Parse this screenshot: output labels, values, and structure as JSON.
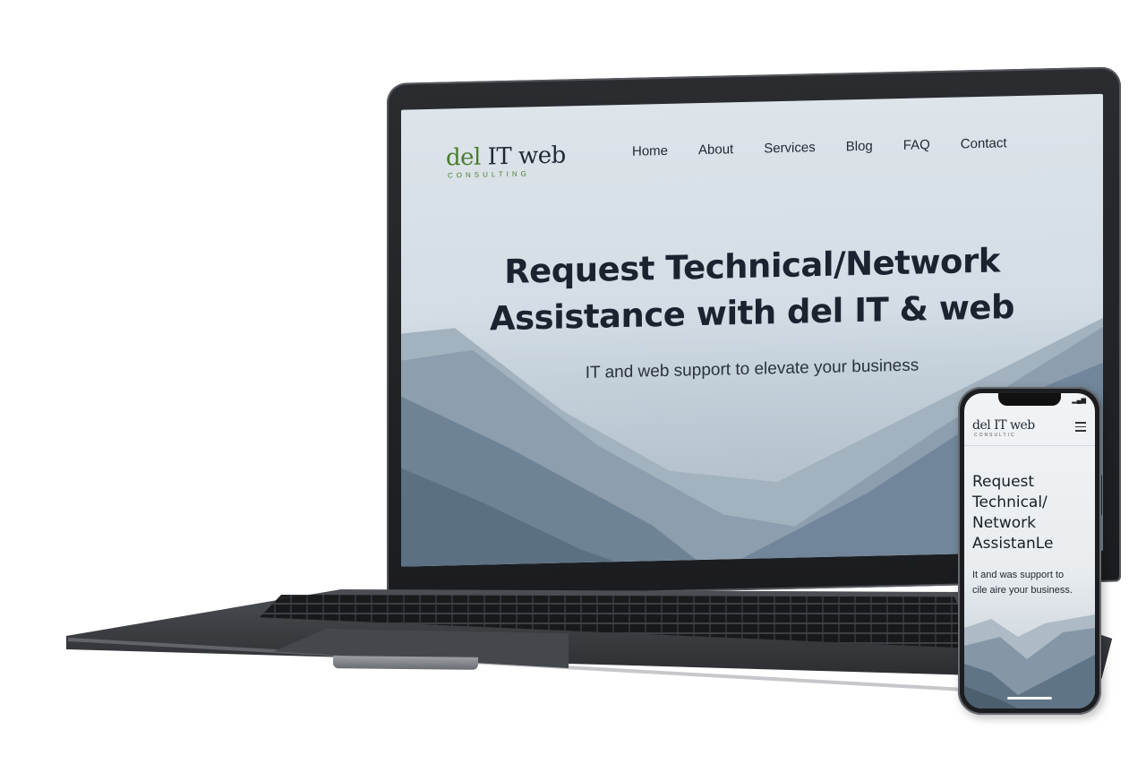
{
  "laptop_site": {
    "logo": {
      "word1": "del",
      "word2": " IT web",
      "tagline": "CONSULTING"
    },
    "nav": [
      "Home",
      "About",
      "Services",
      "Blog",
      "FAQ",
      "Contact"
    ],
    "hero": {
      "title_line1": "Request Technical/Network",
      "title_line2": "Assistance with del IT & web",
      "subtitle": "IT and web support to elevate your business"
    }
  },
  "phone_site": {
    "logo": {
      "text": "del IT web",
      "tagline": "CONSULTIC"
    },
    "status": "▂▄▆",
    "hero": {
      "title_lines": [
        "Request",
        "Technical/",
        "Network",
        "AssistanLe"
      ],
      "subtitle_lines": [
        "It and was support to",
        "cile aire your business."
      ]
    }
  },
  "colors": {
    "logo_green": "#4b7d2e",
    "text_dark": "#1a2430",
    "sky": "#dde4ea",
    "mountain": "#7f92a3"
  },
  "icons": [
    "menu-icon"
  ]
}
